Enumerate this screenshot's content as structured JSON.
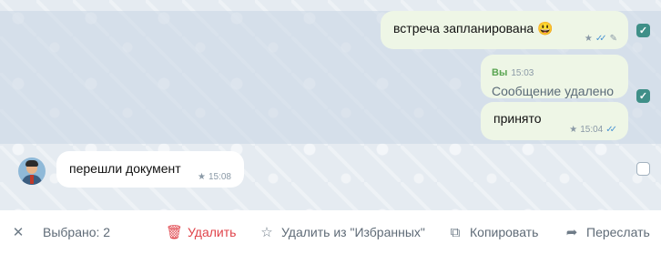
{
  "messages": [
    {
      "text": "встреча запланирована 😃",
      "direction": "out",
      "selected": true,
      "meta_icons": [
        "star-icon",
        "double-check-icon",
        "pencil-icon"
      ]
    },
    {
      "sender": "Вы",
      "sender_time": "15:03",
      "deleted_text": "Сообщение удалено",
      "reply_text": "принято",
      "time": "15:04",
      "direction": "out",
      "selected": true
    },
    {
      "text": "перешли документ",
      "time": "15:08",
      "direction": "in",
      "selected": false
    }
  ],
  "toolbar": {
    "close_icon": "close-icon",
    "selected_label": "Выбрано: 2",
    "delete_label": "Удалить",
    "unstar_label": "Удалить из \"Избранных\"",
    "copy_label": "Копировать",
    "forward_label": "Переслать"
  },
  "colors": {
    "accent": "#3f8f88",
    "danger": "#e0434a",
    "outgoing_bubble": "#eef6e6",
    "sender_name": "#5aa552"
  }
}
